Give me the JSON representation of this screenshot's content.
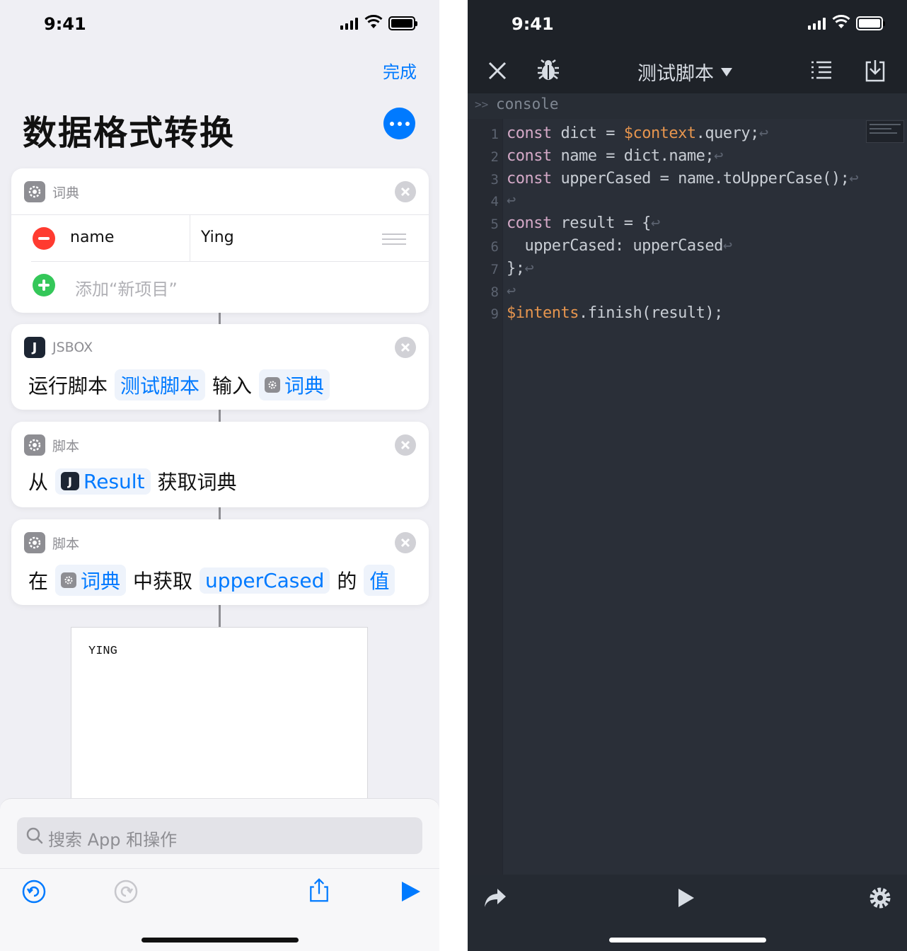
{
  "left": {
    "status": {
      "time": "9:41"
    },
    "done_label": "完成",
    "title": "数据格式转换",
    "dictionary_card": {
      "header": "词典",
      "entries": [
        {
          "key": "name",
          "value": "Ying"
        }
      ],
      "add_label": "添加“新项目”"
    },
    "jsbox_card": {
      "header": "JSBOX",
      "verb": "运行脚本",
      "script_token": "测试脚本",
      "input_word": "输入",
      "input_token": "词典"
    },
    "get_dict_card": {
      "header": "脚本",
      "from_word": "从",
      "source_token": "Result",
      "tail": "获取词典"
    },
    "get_value_card": {
      "header": "脚本",
      "in_word": "在",
      "dict_token": "词典",
      "middle": "中获取",
      "key_token": "upperCased",
      "of_word": "的",
      "value_token": "值"
    },
    "result_text": "YING",
    "search_placeholder": "搜索 App 和操作",
    "accent": "#007aff"
  },
  "right": {
    "status": {
      "time": "9:41"
    },
    "title": "测试脚本",
    "console_prefix": ">>",
    "console_label": "console",
    "code_lines": [
      "const dict = $context.query;",
      "const name = dict.name;",
      "const upperCased = name.toUpperCase();",
      "",
      "const result = {",
      "  upperCased: upperCased",
      "};",
      "",
      "$intents.finish(result);"
    ],
    "line_numbers": [
      "1",
      "2",
      "3",
      "4",
      "5",
      "6",
      "7",
      "8",
      "9"
    ],
    "colors": {
      "background": "#2a2f38",
      "keyword": "#d4a9c7",
      "variable": "#e6954e",
      "text": "#c8cdd4"
    }
  }
}
